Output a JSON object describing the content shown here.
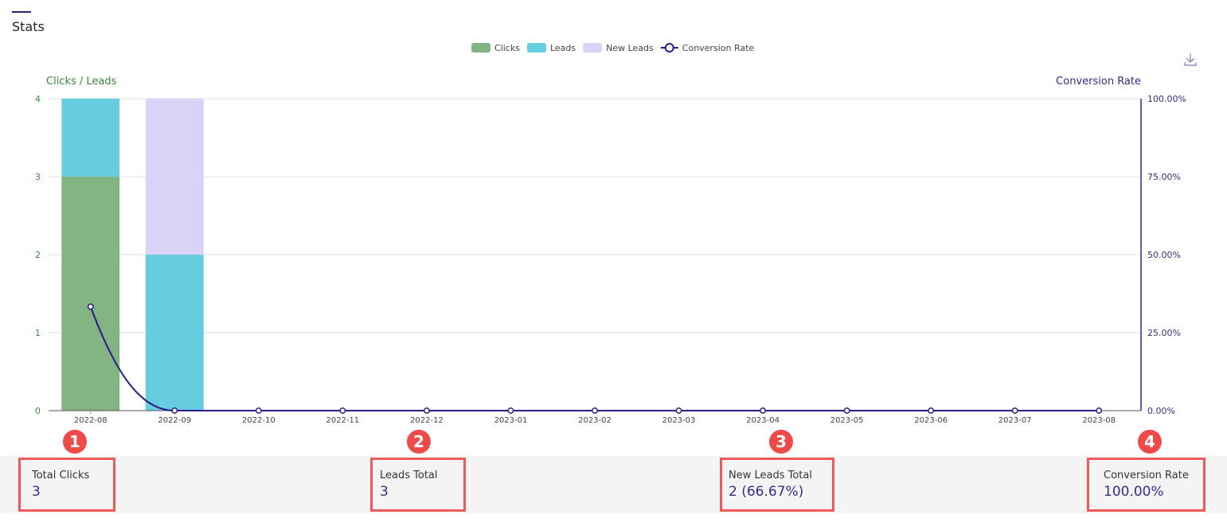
{
  "page": {
    "title": "Stats"
  },
  "chart_data": {
    "type": "bar",
    "categories": [
      "2022-08",
      "2022-09",
      "2022-10",
      "2022-11",
      "2022-12",
      "2023-01",
      "2023-02",
      "2023-03",
      "2023-04",
      "2023-05",
      "2023-06",
      "2023-07",
      "2023-08"
    ],
    "series": [
      {
        "name": "Clicks",
        "type": "bar",
        "stack": "main",
        "axis": "left",
        "color": "#82b383",
        "values": [
          3,
          0,
          0,
          0,
          0,
          0,
          0,
          0,
          0,
          0,
          0,
          0,
          0
        ]
      },
      {
        "name": "Leads",
        "type": "bar",
        "stack": "main",
        "axis": "left",
        "color": "#66cde0",
        "values": [
          1,
          2,
          0,
          0,
          0,
          0,
          0,
          0,
          0,
          0,
          0,
          0,
          0
        ]
      },
      {
        "name": "New Leads",
        "type": "bar",
        "stack": "main",
        "axis": "left",
        "color": "#d8d3f7",
        "values": [
          0,
          2,
          0,
          0,
          0,
          0,
          0,
          0,
          0,
          0,
          0,
          0,
          0
        ]
      },
      {
        "name": "Conversion Rate",
        "type": "line",
        "axis": "right",
        "color": "#2c1b86",
        "values": [
          33.33,
          0,
          0,
          0,
          0,
          0,
          0,
          0,
          0,
          0,
          0,
          0,
          0
        ]
      }
    ],
    "y_left": {
      "label": "Clicks / Leads",
      "ticks": [
        "0",
        "1",
        "2",
        "3",
        "4"
      ],
      "range": [
        0,
        4
      ],
      "color": "#3a8a3a"
    },
    "y_right": {
      "label": "Conversion Rate",
      "ticks": [
        "0.00%",
        "25.00%",
        "50.00%",
        "75.00%",
        "100.00%"
      ],
      "range": [
        0,
        100
      ],
      "color": "#3a2a8a"
    },
    "legend_position": "top-center",
    "grid": true
  },
  "summary": [
    {
      "marker": "1",
      "label": "Total Clicks",
      "value": "3"
    },
    {
      "marker": "2",
      "label": "Leads Total",
      "value": "3"
    },
    {
      "marker": "3",
      "label": "New Leads Total",
      "value": "2 (66.67%)"
    },
    {
      "marker": "4",
      "label": "Conversion Rate",
      "value": "100.00%"
    }
  ],
  "icons": {
    "download": "download-icon"
  }
}
